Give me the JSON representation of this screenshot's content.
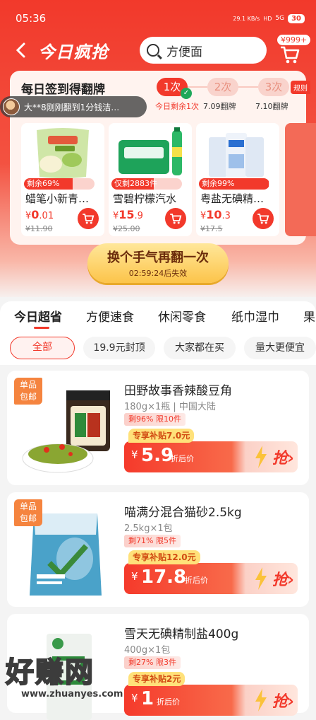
{
  "status": {
    "time": "05:36",
    "net": "29.1 KB/s",
    "hd": "HD",
    "signal": "5G",
    "battery": "30"
  },
  "nav": {
    "title": "今日疯抢",
    "search_text": "方便面",
    "cart_badge": "¥999+"
  },
  "signin": {
    "title": "每日签到得翻牌",
    "steps": [
      {
        "label": "1次",
        "caption": "今日剩余1次"
      },
      {
        "label": "2次",
        "caption": "7.09翻牌"
      },
      {
        "label": "3次",
        "caption": "7.10翻牌"
      }
    ],
    "rules": "规则",
    "marquee": "大**8刚刚翻到1分钱洁…",
    "products": [
      {
        "remain": "剩余69%",
        "remain_pct": 69,
        "name": "蜡笔小新青…",
        "price_symbol": "¥",
        "price_int": "0",
        "price_dec": ".01",
        "orig": "¥11.90"
      },
      {
        "remain": "仅剩2883件",
        "remain_pct": 60,
        "name": "雪碧柠檬汽水",
        "price_symbol": "¥",
        "price_int": "15",
        "price_dec": ".9",
        "orig": "¥25.00"
      },
      {
        "remain": "剩余99%",
        "remain_pct": 99,
        "name": "粤盐无碘精…",
        "price_symbol": "¥",
        "price_int": "10",
        "price_dec": ".3",
        "orig": "¥17.5"
      }
    ],
    "flip_button": "换个手气再翻一次",
    "countdown": "02:59:24后失效"
  },
  "categories": [
    "今日超省",
    "方便速食",
    "休闲零食",
    "纸巾湿巾",
    "果"
  ],
  "chips": [
    "全部",
    "19.9元封顶",
    "大家都在买",
    "量大更便宜"
  ],
  "items": [
    {
      "tag1": "单品",
      "tag2": "包邮",
      "name": "田野故事香辣酸豆角",
      "spec": "180g×1瓶",
      "origin": "中国大陆",
      "stock": "剩96% 限10件",
      "subsidy": "专享补贴7.0元",
      "price_symbol": "¥",
      "price": "5.9",
      "after": "折后价",
      "buy": "抢"
    },
    {
      "tag1": "单品",
      "tag2": "包邮",
      "name": "喵满分混合猫砂2.5kg",
      "spec": "2.5kg×1包",
      "origin": "",
      "stock": "剩71% 限5件",
      "subsidy": "专享补贴12.0元",
      "price_symbol": "¥",
      "price": "17.8",
      "after": "折后价",
      "buy": "抢"
    },
    {
      "tag1": "",
      "tag2": "",
      "name": "雪天无碘精制盐400g",
      "spec": "400g×1包",
      "origin": "",
      "stock": "剩27% 限3件",
      "subsidy": "专享补贴2元",
      "price_symbol": "¥",
      "price": "1",
      "after": "折后价",
      "buy": "抢"
    }
  ],
  "watermark": {
    "main": "好赚网",
    "url": "www.zhuanyes.com"
  },
  "colors": {
    "brand": "#f2392b",
    "coupon": "#ffe17a",
    "tag": "#f5843f"
  }
}
